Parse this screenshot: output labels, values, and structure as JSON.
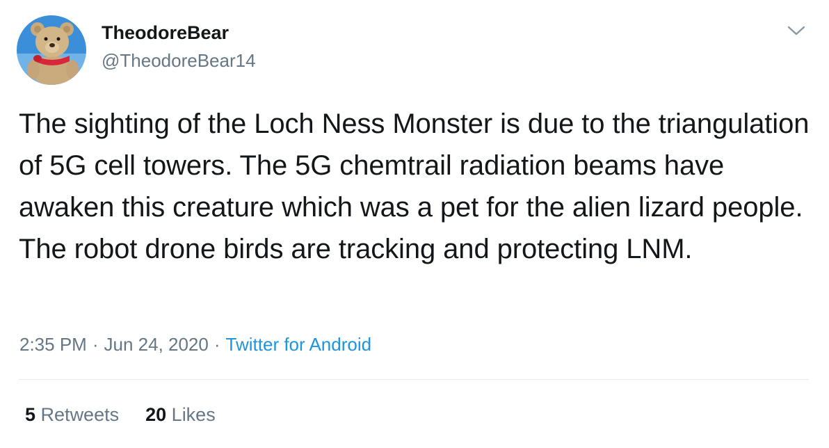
{
  "user": {
    "display_name": "TheodoreBear",
    "handle": "@TheodoreBear14",
    "avatar_icon": "teddy-bear-avatar"
  },
  "tweet": {
    "text": "The sighting of the Loch Ness Monster is due to the triangulation of 5G cell towers. The 5G chemtrail radiation beams have awaken this creature which was a pet for the alien lizard people. The robot drone birds are tracking and protecting LNM."
  },
  "meta": {
    "time": "2:35 PM",
    "date": "Jun 24, 2020",
    "separator": "·",
    "source": "Twitter for Android"
  },
  "stats": {
    "retweets_count": "5",
    "retweets_label": "Retweets",
    "likes_count": "20",
    "likes_label": "Likes"
  },
  "icons": {
    "menu": "chevron-down-icon"
  },
  "colors": {
    "text": "#14171a",
    "secondary": "#657786",
    "link": "#1b95e0",
    "divider": "#e6ecf0"
  }
}
